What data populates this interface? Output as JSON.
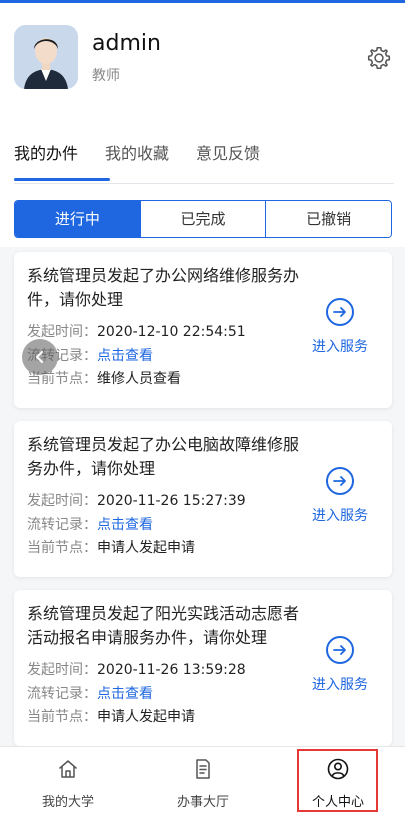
{
  "profile": {
    "name": "admin",
    "role": "教师"
  },
  "tabs": [
    {
      "label": "我的办件",
      "active": true
    },
    {
      "label": "我的收藏",
      "active": false
    },
    {
      "label": "意见反馈",
      "active": false
    }
  ],
  "status_filters": [
    {
      "label": "进行中",
      "active": true
    },
    {
      "label": "已完成",
      "active": false
    },
    {
      "label": "已撤销",
      "active": false
    }
  ],
  "labels": {
    "time": "发起时间：",
    "flow": "流转记录：",
    "node": "当前节点：",
    "view_link": "点击查看",
    "enter": "进入服务"
  },
  "tasks": [
    {
      "title": "系统管理员发起了办公网络维修服务办件，请你处理",
      "time": "2020-12-10 22:54:51",
      "node": "维修人员查看"
    },
    {
      "title": "系统管理员发起了办公电脑故障维修服务办件，请你处理",
      "time": "2020-11-26 15:27:39",
      "node": "申请人发起申请"
    },
    {
      "title": "系统管理员发起了阳光实践活动志愿者活动报名申请服务办件，请你处理",
      "time": "2020-11-26 13:59:28",
      "node": "申请人发起申请"
    }
  ],
  "bottom_nav": [
    {
      "label": "我的大学",
      "icon": "home-icon"
    },
    {
      "label": "办事大厅",
      "icon": "document-icon"
    },
    {
      "label": "个人中心",
      "icon": "user-icon",
      "active": true
    }
  ],
  "colors": {
    "accent": "#1f67e0",
    "highlight": "#e53935"
  }
}
